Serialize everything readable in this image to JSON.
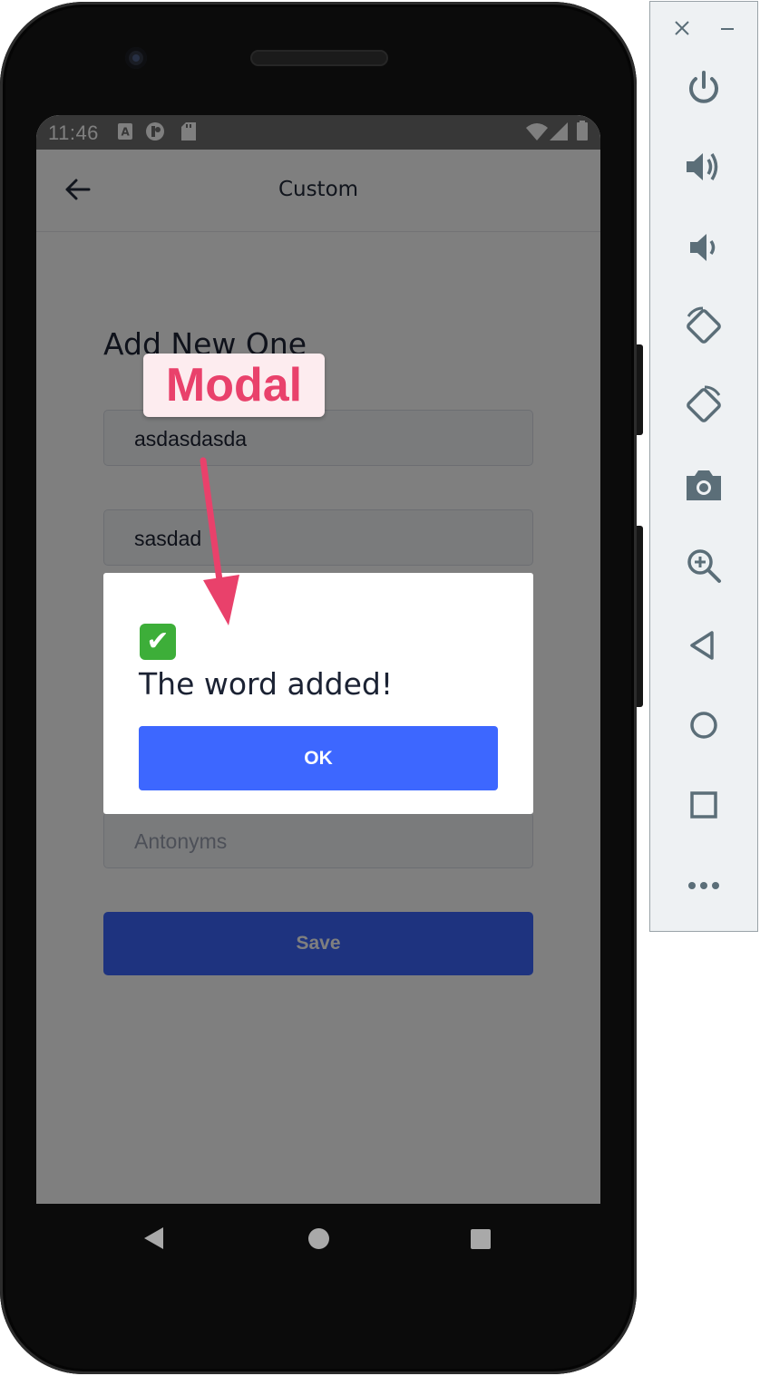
{
  "status_bar": {
    "time": "11:46"
  },
  "app_bar": {
    "title": "Custom"
  },
  "form": {
    "title": "Add New One",
    "word_value": "asdasdasda",
    "meaning_value": "sasdad",
    "antonyms_placeholder": "Antonyms",
    "save_label": "Save"
  },
  "modal": {
    "icon": "✔",
    "message": "The word added!",
    "ok_label": "OK"
  },
  "annotation": {
    "label": "Modal",
    "color": "#e9416b"
  },
  "emulator_toolbar": {
    "buttons": [
      "close",
      "minimize",
      "power",
      "volume-up",
      "volume-down",
      "rotate-left",
      "rotate-right",
      "screenshot",
      "zoom",
      "back",
      "home",
      "overview",
      "more"
    ]
  },
  "colors": {
    "primary": "#3d67ff",
    "overlay": "rgba(0,0,0,0.5)"
  }
}
